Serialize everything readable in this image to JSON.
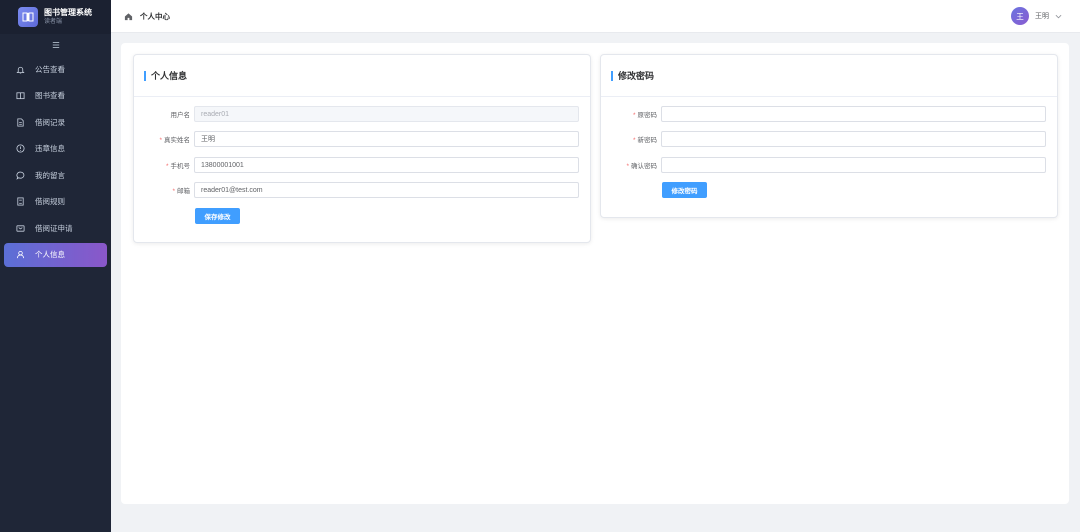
{
  "brand": {
    "title": "图书管理系统",
    "subtitle": "读者端"
  },
  "sidebar": {
    "items": [
      {
        "label": "公告查看",
        "icon": "bell-icon"
      },
      {
        "label": "图书查看",
        "icon": "book-icon"
      },
      {
        "label": "借阅记录",
        "icon": "document-icon"
      },
      {
        "label": "违章信息",
        "icon": "warning-icon"
      },
      {
        "label": "我的留言",
        "icon": "message-icon"
      },
      {
        "label": "借阅规则",
        "icon": "notebook-icon"
      },
      {
        "label": "借阅证申请",
        "icon": "card-icon"
      },
      {
        "label": "个人信息",
        "icon": "user-icon"
      }
    ],
    "active_index": 7
  },
  "header": {
    "breadcrumb": "个人中心",
    "avatar_char": "王",
    "username": "王明"
  },
  "profile": {
    "title": "个人信息",
    "fields": {
      "username": {
        "label": "用户名",
        "value": "reader01"
      },
      "realname": {
        "label": "真实姓名",
        "value": "王明"
      },
      "phone": {
        "label": "手机号",
        "value": "13800001001"
      },
      "email": {
        "label": "邮箱",
        "value": "reader01@test.com"
      }
    },
    "save_label": "保存修改"
  },
  "password": {
    "title": "修改密码",
    "fields": {
      "old": {
        "label": "原密码",
        "value": ""
      },
      "new": {
        "label": "新密码",
        "value": ""
      },
      "confirm": {
        "label": "确认密码",
        "value": ""
      }
    },
    "submit_label": "修改密码"
  },
  "colors": {
    "sidebar_bg": "#1f2637",
    "active_gradient_start": "#5b6fd6",
    "active_gradient_end": "#8a57c9",
    "primary": "#409eff",
    "required": "#f56c6c"
  }
}
